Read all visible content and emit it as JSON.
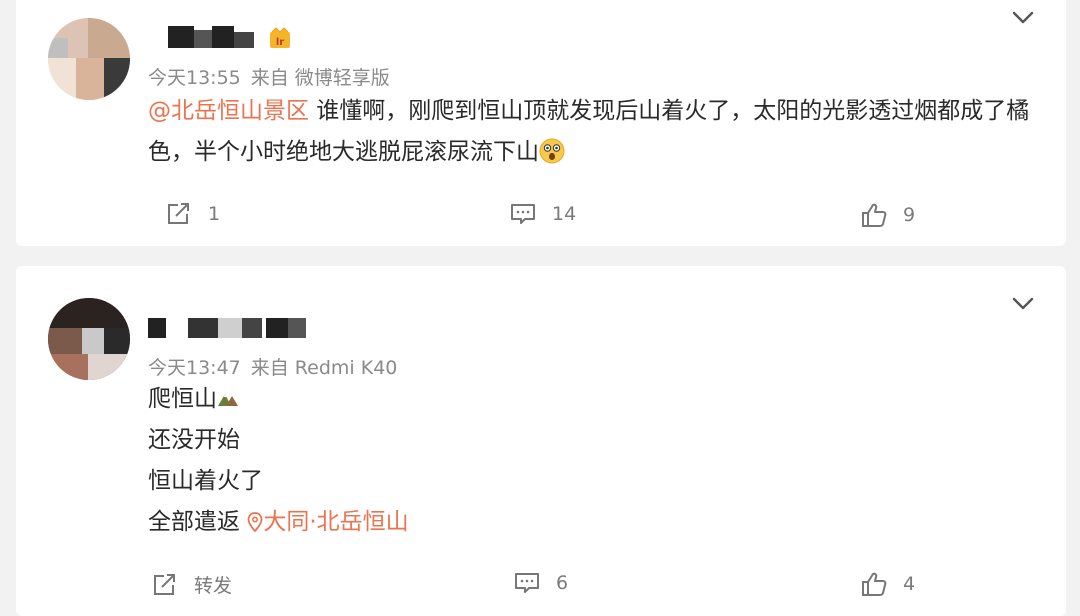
{
  "comments": [
    {
      "time": "今天13:55",
      "source": "来自 微博轻享版",
      "mention": "@北岳恒山景区",
      "text_line1": " 谁懂啊，刚爬到恒山顶就发现后山着火了，太阳的光影透过烟都成了橘",
      "text_line2": "色，半个小时绝地大逃脱屁滚尿流下山",
      "emoji_icon": "shocked-face-icon",
      "repost_count": "1",
      "comment_count": "14",
      "like_count": "9"
    },
    {
      "time": "今天13:47",
      "source": "来自 Redmi K40",
      "lines": [
        "爬恒山",
        "还没开始",
        "恒山着火了",
        "全部遣返"
      ],
      "location": "大同·北岳恒山",
      "repost_label": "转发",
      "comment_count": "6",
      "like_count": "4"
    }
  ],
  "colors": {
    "accent": "#eb7350",
    "meta": "#8a8a8a",
    "text": "#2a2a2a",
    "background": "#f2f2f2"
  }
}
